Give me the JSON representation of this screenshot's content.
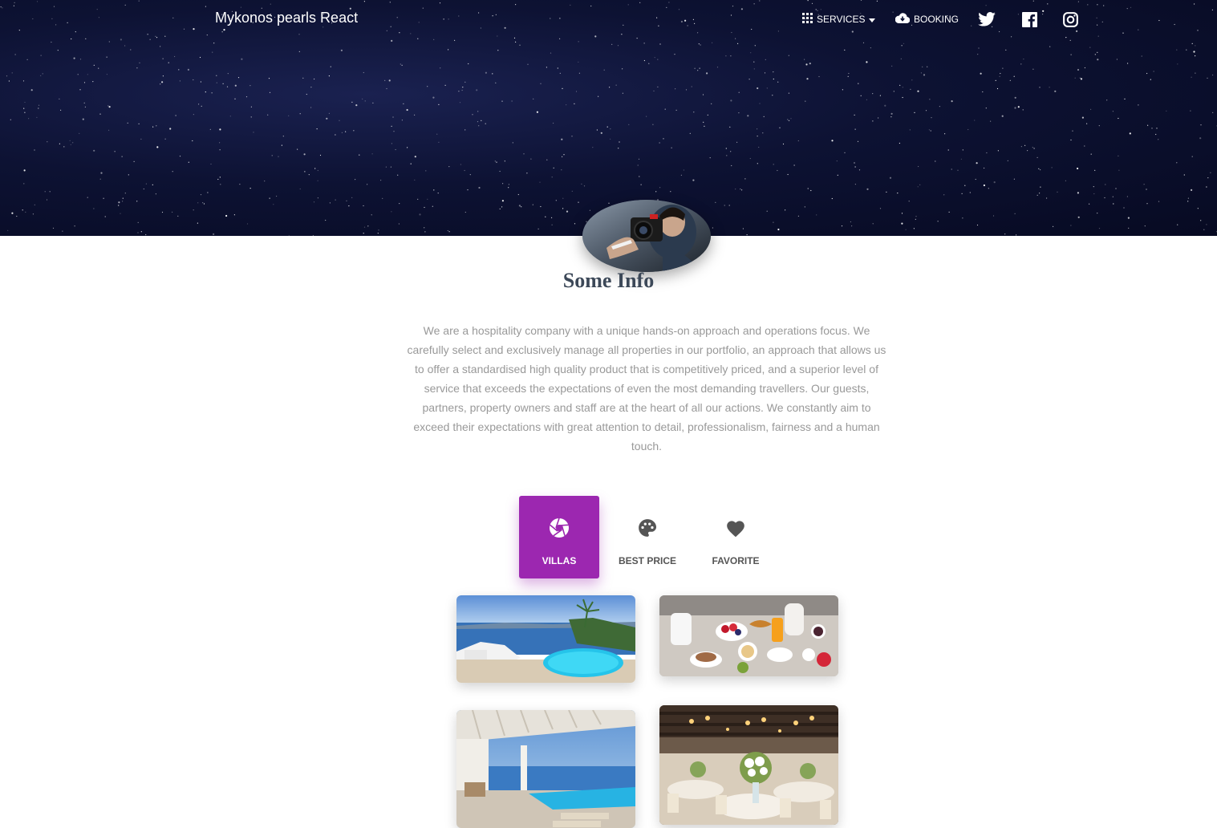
{
  "navbar": {
    "brand": "Mykonos pearls React",
    "services_label": "Services",
    "booking_label": "Booking",
    "icons": {
      "services": "apps-grid-icon",
      "services_caret": "caret-down-icon",
      "booking": "cloud-download-icon",
      "twitter": "twitter-icon",
      "facebook": "facebook-icon",
      "instagram": "instagram-icon"
    }
  },
  "hero": {
    "background": "starry-night-sky",
    "avatar": "photographer-with-camera"
  },
  "section": {
    "title": "Some Info",
    "description": "We are a hospitality company with a unique hands-on approach and operations focus. We carefully select and exclusively manage all properties in our portfolio, an approach that allows us to offer a standardised high quality product that is competitively priced, and a superior level of service that exceeds the expectations of even the most demanding travellers. Our guests, partners, property owners and staff are at the heart of all our actions. We constantly aim to exceed their expectations with great attention to detail, professionalism, fairness and a human touch."
  },
  "tabs": [
    {
      "label": "Villas",
      "icon": "camera-aperture-icon",
      "active": true
    },
    {
      "label": "Best Price",
      "icon": "palette-icon",
      "active": false
    },
    {
      "label": "Favorite",
      "icon": "heart-icon",
      "active": false
    }
  ],
  "gallery": [
    {
      "subject": "villa terrace with pool and sea view"
    },
    {
      "subject": "breakfast table spread"
    },
    {
      "subject": "covered patio with infinity pool"
    },
    {
      "subject": "banquet hall with floral centerpieces"
    }
  ],
  "colors": {
    "accent": "#9c27b0",
    "title": "#3c4858",
    "description": "#999999",
    "tab_text": "#555555"
  }
}
